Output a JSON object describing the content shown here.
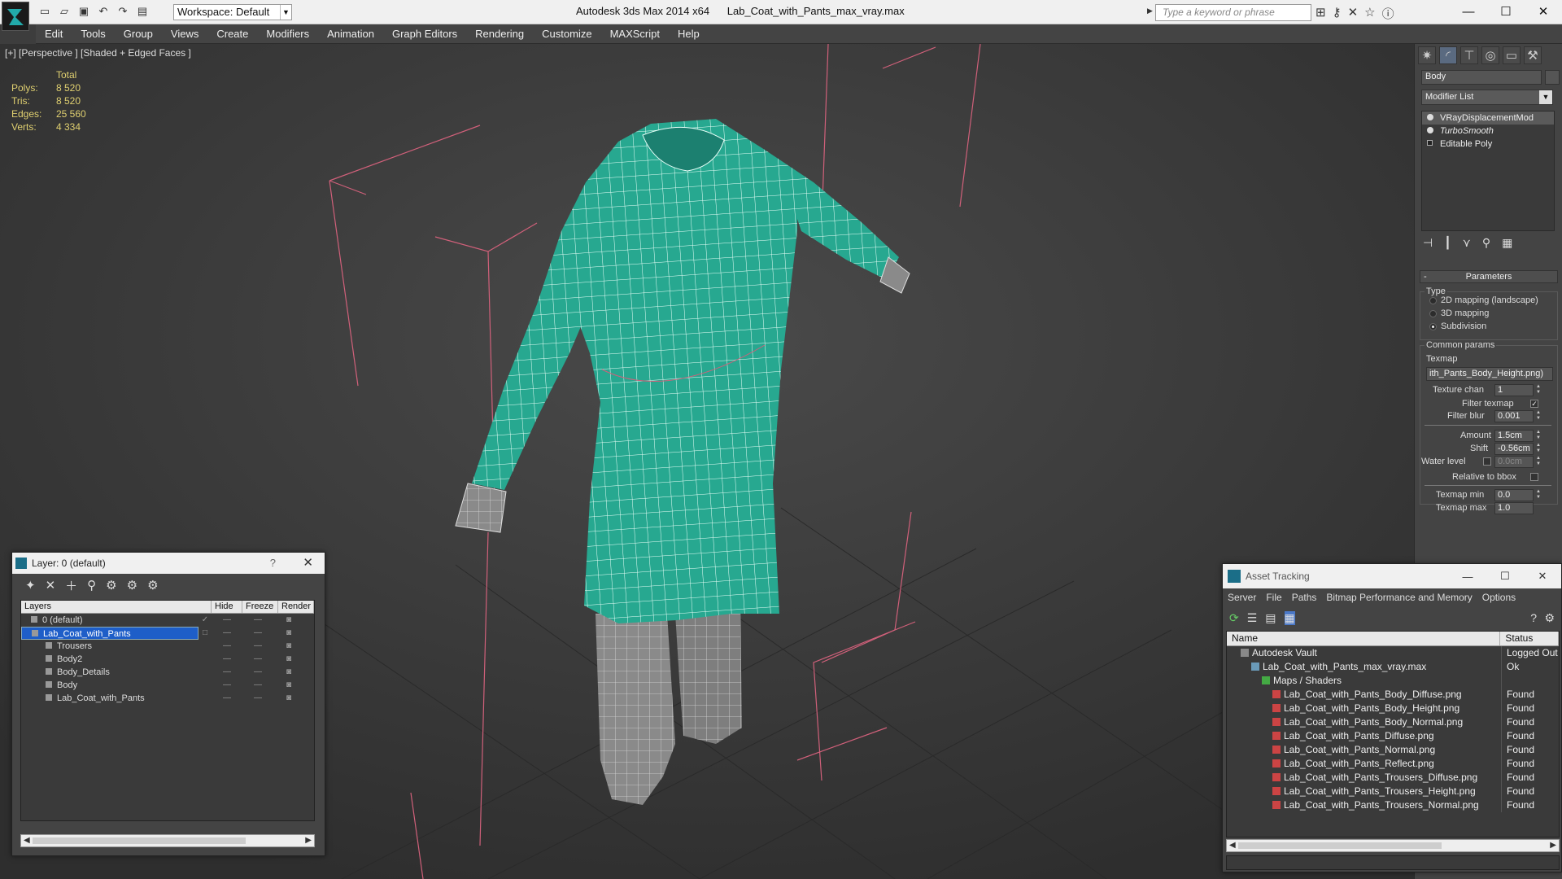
{
  "app": {
    "title": "Autodesk 3ds Max 2014 x64",
    "file": "Lab_Coat_with_Pants_max_vray.max",
    "workspace": "Workspace: Default",
    "search_placeholder": "Type a keyword or phrase"
  },
  "menu": [
    "Edit",
    "Tools",
    "Group",
    "Views",
    "Create",
    "Modifiers",
    "Animation",
    "Graph Editors",
    "Rendering",
    "Customize",
    "MAXScript",
    "Help"
  ],
  "viewport": {
    "label": "[+] [Perspective ] [Shaded + Edged Faces ]",
    "stats_header": "Total",
    "stats": [
      {
        "k": "Polys:",
        "v": "8 520"
      },
      {
        "k": "Tris:",
        "v": "8 520"
      },
      {
        "k": "Edges:",
        "v": "25 560"
      },
      {
        "k": "Verts:",
        "v": "4 334"
      }
    ],
    "colors": {
      "cloth": "#27a890",
      "pants": "#8a8a8a",
      "bbox": "#d0607a",
      "bg": "#3a3a3a"
    }
  },
  "right_panel": {
    "name": "Body",
    "modifier_list": "Modifier List",
    "stack": [
      "VRayDisplacementMod",
      "TurboSmooth",
      "Editable Poly"
    ],
    "parameters_title": "Parameters",
    "type_label": "Type",
    "type_options": [
      "2D mapping (landscape)",
      "3D mapping",
      "Subdivision"
    ],
    "common_params": "Common params",
    "texmap_label": "Texmap",
    "texmap_value": "ith_Pants_Body_Height.png)",
    "texture_chan_label": "Texture chan",
    "texture_chan": "1",
    "filter_texmap": "Filter texmap",
    "filter_blur_label": "Filter blur",
    "filter_blur": "0.001",
    "amount_label": "Amount",
    "amount": "1.5cm",
    "shift_label": "Shift",
    "shift": "-0.56cm",
    "water_level_label": "Water level",
    "water_level": "0.0cm",
    "relative_bbox": "Relative to bbox",
    "texmap_min_label": "Texmap min",
    "texmap_min": "0.0",
    "texmap_max_label": "Texmap max",
    "texmap_max": "1.0"
  },
  "layer_window": {
    "title": "Layer: 0 (default)",
    "help": "?",
    "columns": [
      "Layers",
      "Hide",
      "Freeze",
      "Render"
    ],
    "rows": [
      {
        "name": "0 (default)",
        "indent": 1
      },
      {
        "name": "Lab_Coat_with_Pants",
        "indent": 1,
        "selected": true
      },
      {
        "name": "Trousers",
        "indent": 2
      },
      {
        "name": "Body2",
        "indent": 2
      },
      {
        "name": "Body_Details",
        "indent": 2
      },
      {
        "name": "Body",
        "indent": 2
      },
      {
        "name": "Lab_Coat_with_Pants",
        "indent": 2
      }
    ]
  },
  "asset_tracking": {
    "title": "Asset Tracking",
    "menu": [
      "Server",
      "File",
      "Paths",
      "Bitmap Performance and Memory",
      "Options"
    ],
    "columns": [
      "Name",
      "Status"
    ],
    "rows": [
      {
        "name": "Autodesk Vault",
        "status": "Logged Out",
        "indent": 1,
        "icon": "vault"
      },
      {
        "name": "Lab_Coat_with_Pants_max_vray.max",
        "status": "Ok",
        "indent": 2,
        "icon": "max"
      },
      {
        "name": "Maps / Shaders",
        "status": "",
        "indent": 3,
        "icon": "maps"
      },
      {
        "name": "Lab_Coat_with_Pants_Body_Diffuse.png",
        "status": "Found",
        "indent": 4,
        "icon": "png"
      },
      {
        "name": "Lab_Coat_with_Pants_Body_Height.png",
        "status": "Found",
        "indent": 4,
        "icon": "png"
      },
      {
        "name": "Lab_Coat_with_Pants_Body_Normal.png",
        "status": "Found",
        "indent": 4,
        "icon": "png"
      },
      {
        "name": "Lab_Coat_with_Pants_Diffuse.png",
        "status": "Found",
        "indent": 4,
        "icon": "png"
      },
      {
        "name": "Lab_Coat_with_Pants_Normal.png",
        "status": "Found",
        "indent": 4,
        "icon": "png"
      },
      {
        "name": "Lab_Coat_with_Pants_Reflect.png",
        "status": "Found",
        "indent": 4,
        "icon": "png"
      },
      {
        "name": "Lab_Coat_with_Pants_Trousers_Diffuse.png",
        "status": "Found",
        "indent": 4,
        "icon": "png"
      },
      {
        "name": "Lab_Coat_with_Pants_Trousers_Height.png",
        "status": "Found",
        "indent": 4,
        "icon": "png"
      },
      {
        "name": "Lab_Coat_with_Pants_Trousers_Normal.png",
        "status": "Found",
        "indent": 4,
        "icon": "png"
      }
    ]
  }
}
